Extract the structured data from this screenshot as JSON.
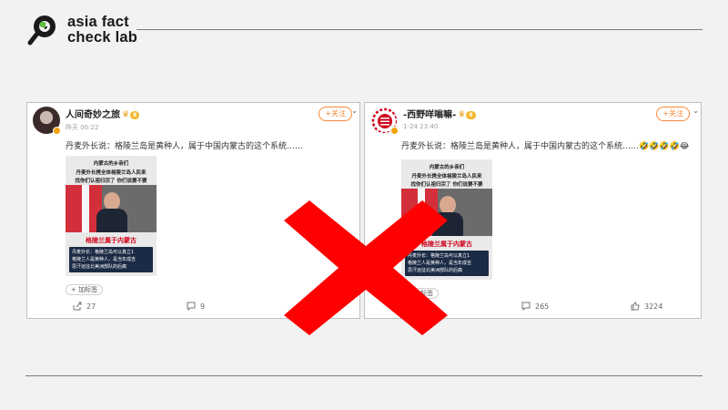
{
  "brand": {
    "line1": "asia fact",
    "line2": "check lab"
  },
  "colors": {
    "accent": "#f5893a",
    "x_mark": "#ff0000",
    "rule": "#7a7a7a"
  },
  "posts": [
    {
      "username": "人间奇妙之旅",
      "level": "8",
      "meta": "昨天 00:22",
      "follow_label": "+关注",
      "text": "丹麦外长说：格陵兰岛是黄种人，属于中国内蒙古的这个系统……",
      "thumbnail": {
        "line1": "内蒙古的乡亲们",
        "line2": "丹麦外长携全体格陵兰岛人民来",
        "line3": "找你们认祖归宗了 你们说要不要",
        "red_caption": "格陵兰属于内蒙古",
        "captions": [
          "丹麦外长：格陵兰岛可以真立1",
          "格陵兰人是黄种人，是当年成吉",
          "思汗远征北美洲部队的后裔"
        ]
      },
      "add_tag": "+ 加标签",
      "shares": "27",
      "comments": "9"
    },
    {
      "username": "-西野咩嗡嘛-",
      "level": "8",
      "meta": "1-24 23:40",
      "follow_label": "+关注",
      "text": "丹麦外长说：格陵兰岛是黄种人，属于中国内蒙古的这个系统……🤣🤣🤣🤣😂",
      "thumbnail": {
        "line1": "内蒙古的乡亲们",
        "line2": "丹麦外长携全体格陵兰岛人民来",
        "line3": "找你们认祖归宗了 你们说要不要",
        "red_caption": "格陵兰属于内蒙古",
        "captions": [
          "丹麦外长：格陵兰岛可以真立1",
          "格陵兰人是黄种人，是当年成吉",
          "思汗远征北美洲部队的后裔"
        ]
      },
      "add_tag": "+ 加标签",
      "comments": "265",
      "likes": "3224"
    }
  ]
}
